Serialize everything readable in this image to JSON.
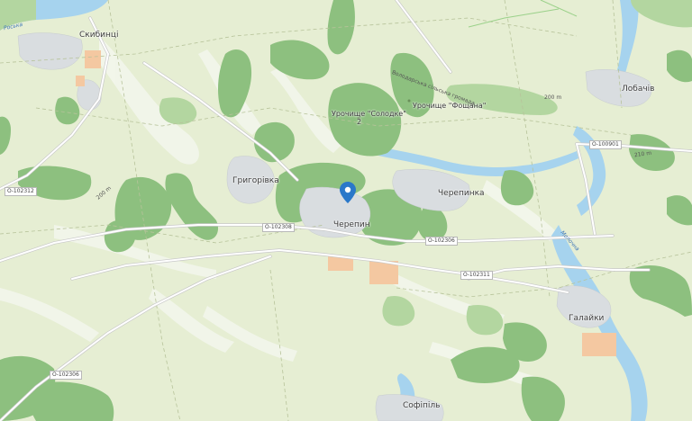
{
  "map": {
    "colors": {
      "land": "#e6eed3",
      "forest": "#8dc07f",
      "forest_light": "#b3d6a0",
      "water": "#a6d3ee",
      "settlement": "#d9dde0",
      "industrial": "#f4c8a1",
      "road": "#ffffff",
      "pin": "#2a78c9"
    },
    "places": {
      "skyvyntsi": "Скибинці",
      "hryhorivka": "Григорівка",
      "cherepyn": "Черепин",
      "cherepynka": "Черепинка",
      "lobachiv": "Лобачів",
      "halaiky": "Галайки",
      "sofiipil": "Софіпіль"
    },
    "tracts": {
      "solodke": "Урочище \"Солодке\"",
      "solodke_num": "2",
      "foshchana": "Урочище \"Фощана\""
    },
    "roads": {
      "r1": "О-102312",
      "r2": "О-102308",
      "r3": "О-102306",
      "r4": "О-102311",
      "r5": "О-100901",
      "r6": "О-102306"
    },
    "water_labels": {
      "roska": "Роська",
      "molochna": "Молочна"
    },
    "misc_labels": {
      "volodarska": "Володарська сільська громада",
      "m200a": "200 m",
      "m200b": "200 m",
      "m210": "210 m"
    },
    "marker": {
      "icon": "map-pin-icon"
    }
  }
}
